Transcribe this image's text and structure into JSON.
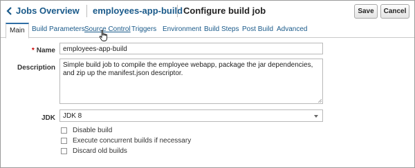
{
  "header": {
    "back_label": "Jobs Overview",
    "job_name": "employees-app-build",
    "page_title": "Configure build job",
    "save_label": "Save",
    "cancel_label": "Cancel"
  },
  "tabs": [
    {
      "label": "Main",
      "active": true
    },
    {
      "label": "Build Parameters"
    },
    {
      "label": "Source Control"
    },
    {
      "label": "Triggers"
    },
    {
      "label": "Environment"
    },
    {
      "label": "Build Steps"
    },
    {
      "label": "Post Build"
    },
    {
      "label": "Advanced"
    }
  ],
  "form": {
    "name_required_mark": "*",
    "name_label": "Name",
    "name_value": "employees-app-build",
    "description_label": "Description",
    "description_value": "Simple build job to compile the employee webapp, package the jar dependencies, and zip up the manifest.json descriptor.",
    "jdk_label": "JDK",
    "jdk_value": "JDK 8",
    "options": [
      {
        "label": "Disable build",
        "checked": false
      },
      {
        "label": "Execute concurrent builds if necessary",
        "checked": false
      },
      {
        "label": "Discard old builds",
        "checked": false
      }
    ]
  },
  "colors": {
    "link": "#1a5a8a",
    "active_tab_border": "#2e6da4",
    "required": "#cc0000"
  }
}
